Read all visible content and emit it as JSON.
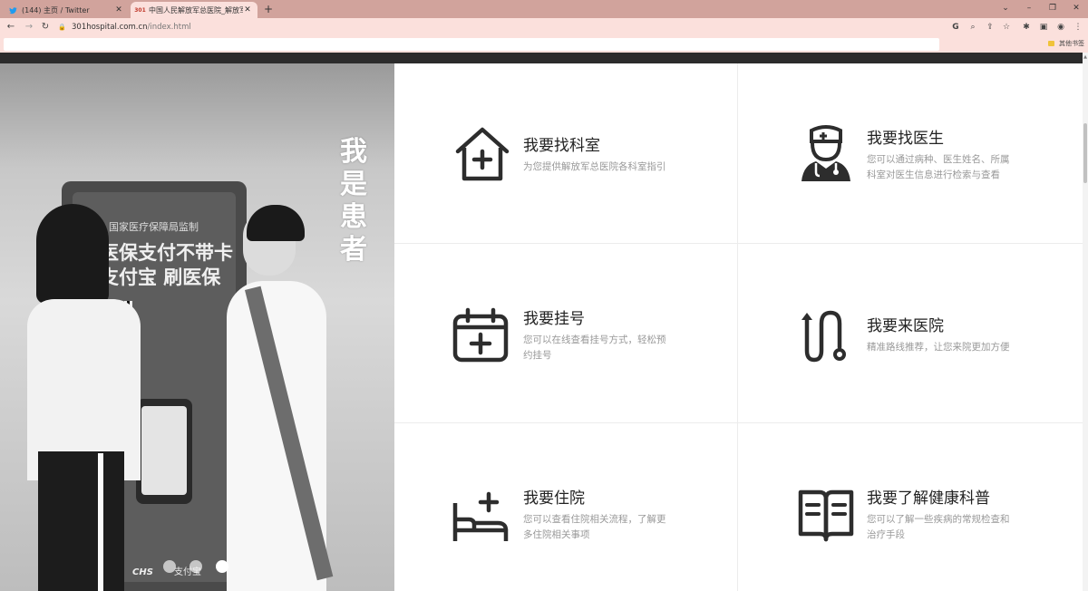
{
  "browser": {
    "tabs": [
      {
        "title": "(144) 主页 / Twitter",
        "icon": "twitter-bird-icon"
      },
      {
        "title": "中国人民解放军总医院_解放军总",
        "icon": "hospital-logo-icon",
        "favicon_text": "301"
      }
    ],
    "url_host": "301hospital.com.cn",
    "url_path": "/index.html",
    "bookmarks_folder": "其他书签"
  },
  "hero": {
    "vertical_title": "我是患者",
    "sign_top": "国家医疗保障局监制",
    "sign_line1": "医保支付不带卡",
    "sign_line2": "支付宝 刷医保",
    "logo_chs": "CHS",
    "logo_alipay": "支付宝",
    "carousel_count": 3,
    "carousel_active": 3
  },
  "services": [
    {
      "title": "我要找科室",
      "desc": "为您提供解放军总医院各科室指引",
      "icon": "house-plus-icon"
    },
    {
      "title": "我要找医生",
      "desc": "您可以通过病种、医生姓名、所属科室对医生信息进行检索与查看",
      "icon": "doctor-icon"
    },
    {
      "title": "我要挂号",
      "desc": "您可以在线查看挂号方式，轻松预约挂号",
      "icon": "calendar-plus-icon"
    },
    {
      "title": "我要来医院",
      "desc": "精准路线推荐，让您来院更加方便",
      "icon": "route-icon"
    },
    {
      "title": "我要住院",
      "desc": "您可以查看住院相关流程，了解更多住院相关事项",
      "icon": "hospital-bed-icon"
    },
    {
      "title": "我要了解健康科普",
      "desc": "您可以了解一些疾病的常规检查和治疗手段",
      "icon": "open-book-icon"
    }
  ]
}
